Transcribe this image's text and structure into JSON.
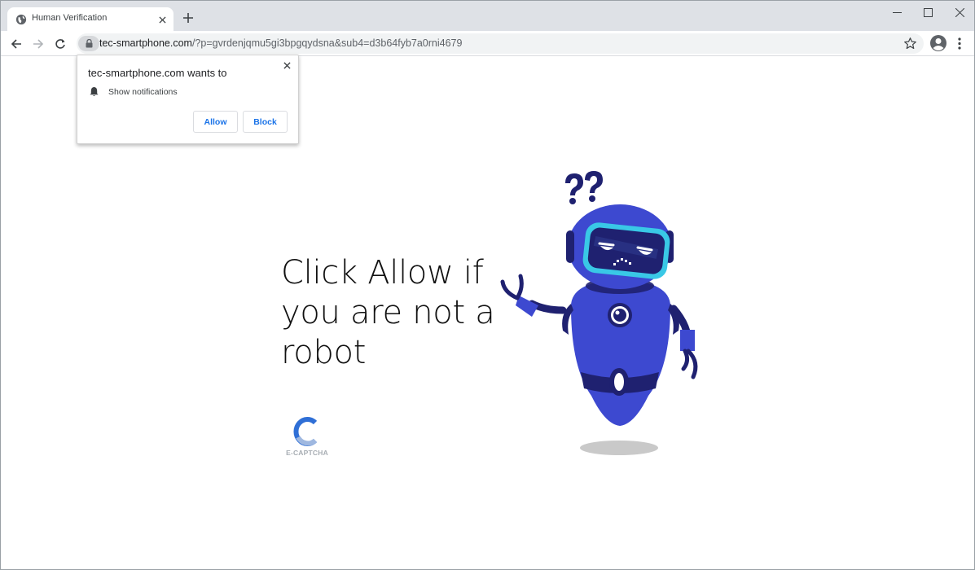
{
  "browser": {
    "tab_title": "Human Verification",
    "url_host": "tec-smartphone.com",
    "url_path": "/?p=gvrdenjqmu5gi3bpgqydsna&sub4=d3b64fyb7a0rni4679"
  },
  "popup": {
    "title": "tec-smartphone.com wants to",
    "permission": "Show notifications",
    "allow_label": "Allow",
    "block_label": "Block"
  },
  "page": {
    "headline_lines": [
      "Click Allow if",
      "you are not a",
      "robot"
    ],
    "captcha_label": "E-CAPTCHA"
  },
  "colors": {
    "robot_body": "#3d49d0",
    "robot_dark": "#1f2170",
    "visor_glow": "#39c8e6",
    "link_blue": "#1a73e8"
  }
}
